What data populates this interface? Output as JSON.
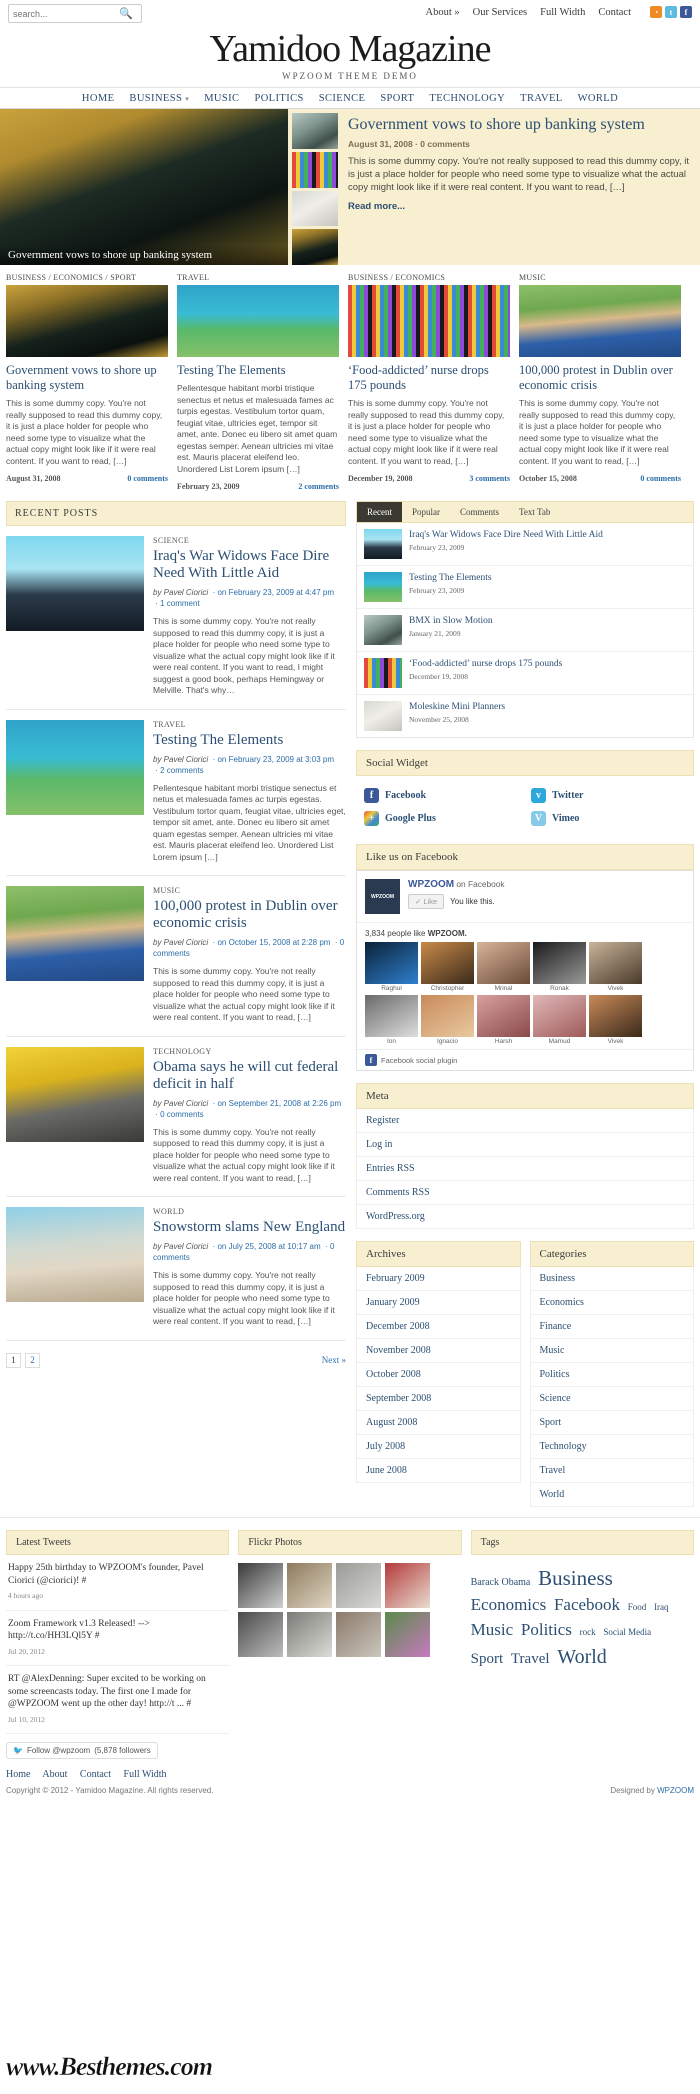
{
  "topbar": {
    "search_placeholder": "search...",
    "search_value": "",
    "search_icon": "search-icon",
    "links": [
      {
        "label": "About »"
      },
      {
        "label": "Our Services"
      },
      {
        "label": "Full Width"
      },
      {
        "label": "Contact"
      }
    ],
    "social": [
      {
        "name": "rss",
        "glyph": "◔"
      },
      {
        "name": "twitter",
        "glyph": "t"
      },
      {
        "name": "facebook",
        "glyph": "f"
      }
    ]
  },
  "masthead": {
    "logo": "Yamidoo Magazine",
    "tagline": "WPZOOM THEME DEMO"
  },
  "mainnav": [
    {
      "label": "HOME",
      "caret": ""
    },
    {
      "label": "BUSINESS",
      "caret": "▾"
    },
    {
      "label": "MUSIC",
      "caret": ""
    },
    {
      "label": "POLITICS",
      "caret": ""
    },
    {
      "label": "SCIENCE",
      "caret": ""
    },
    {
      "label": "SPORT",
      "caret": ""
    },
    {
      "label": "TECHNOLOGY",
      "caret": ""
    },
    {
      "label": "TRAVEL",
      "caret": ""
    },
    {
      "label": "WORLD",
      "caret": ""
    }
  ],
  "featured": {
    "caption": "Government vows to shore up banking system",
    "title": "Government vows to shore up banking system",
    "meta": "August 31, 2008 · 0 comments",
    "body": "This is some dummy copy. You're not really supposed to read this dummy copy, it is just a place holder for people who need some type to visualize what the actual copy might look like if it were real content. If you want to read, […]",
    "read_more": "Read more..."
  },
  "columns": [
    {
      "category": "BUSINESS / ECONOMICS / SPORT",
      "title": "Government vows to shore up banking system",
      "body": "This is some dummy copy. You're not really supposed to read this dummy copy, it is just a place holder for people who need some type to visualize what the actual copy might look like if it were real content. If you want to read, […]",
      "date": "August 31, 2008",
      "comments": "0 comments"
    },
    {
      "category": "TRAVEL",
      "title": "Testing The Elements",
      "body": "Pellentesque habitant morbi tristique senectus et netus et malesuada fames ac turpis egestas. Vestibulum tortor quam, feugiat vitae, ultricies eget, tempor sit amet, ante. Donec eu libero sit amet quam egestas semper. Aenean ultricies mi vitae est. Mauris placerat eleifend leo. Unordered List Lorem ipsum […]",
      "date": "February 23, 2009",
      "comments": "2 comments"
    },
    {
      "category": "BUSINESS / ECONOMICS",
      "title": "‘Food-addicted’ nurse drops 175 pounds",
      "body": "This is some dummy copy. You're not really supposed to read this dummy copy, it is just a place holder for people who need some type to visualize what the actual copy might look like if it were real content. If you want to read, […]",
      "date": "December 19, 2008",
      "comments": "3 comments"
    },
    {
      "category": "MUSIC",
      "title": "100,000 protest in Dublin over economic crisis",
      "body": "This is some dummy copy. You're not really supposed to read this dummy copy, it is just a place holder for people who need some type to visualize what the actual copy might look like if it were real content. If you want to read, […]",
      "date": "October 15, 2008",
      "comments": "0 comments"
    }
  ],
  "recent_posts": {
    "heading": "RECENT POSTS",
    "items": [
      {
        "category": "SCIENCE",
        "title": "Iraq's War Widows Face Dire Need With Little Aid",
        "meta_by": "by Pavel Ciorici",
        "meta_date": "on February 23, 2009 at 4:47 pm",
        "meta_comments": "1 comment",
        "body": "This is some dummy copy. You're not really supposed to read this dummy copy, it is just a place holder for people who need some type to visualize what the actual copy might look like if it were real content. If you want to read, I might suggest a good book, perhaps Hemingway or Melville. That's why…"
      },
      {
        "category": "TRAVEL",
        "title": "Testing The Elements",
        "meta_by": "by Pavel Ciorici",
        "meta_date": "on February 23, 2009 at 3:03 pm",
        "meta_comments": "2 comments",
        "body": "Pellentesque habitant morbi tristique senectus et netus et malesuada fames ac turpis egestas. Vestibulum tortor quam, feugiat vitae, ultricies eget, tempor sit amet, ante. Donec eu libero sit amet quam egestas semper. Aenean ultricies mi vitae est. Mauris placerat eleifend leo. Unordered List Lorem ipsum […]"
      },
      {
        "category": "MUSIC",
        "title": "100,000 protest in Dublin over economic crisis",
        "meta_by": "by Pavel Ciorici",
        "meta_date": "on October 15, 2008 at 2:28 pm",
        "meta_comments": "0 comments",
        "body": "This is some dummy copy. You're not really supposed to read this dummy copy, it is just a place holder for people who need some type to visualize what the actual copy might look like if it were real content. If you want to read, […]"
      },
      {
        "category": "TECHNOLOGY",
        "title": "Obama says he will cut federal deficit in half",
        "meta_by": "by Pavel Ciorici",
        "meta_date": "on September 21, 2008 at 2:26 pm",
        "meta_comments": "0 comments",
        "body": "This is some dummy copy. You're not really supposed to read this dummy copy, it is just a place holder for people who need some type to visualize what the actual copy might look like if it were real content. If you want to read, […]"
      },
      {
        "category": "WORLD",
        "title": "Snowstorm slams New England",
        "meta_by": "by Pavel Ciorici",
        "meta_date": "on July 25, 2008 at 10:17 am",
        "meta_comments": "0 comments",
        "body": "This is some dummy copy. You're not really supposed to read this dummy copy, it is just a place holder for people who need some type to visualize what the actual copy might look like if it were real content. If you want to read, […]"
      }
    ],
    "pagination": {
      "pages": [
        "1",
        "2"
      ],
      "current": "1",
      "next": "Next »"
    }
  },
  "sidebar": {
    "tabs": [
      {
        "label": "Recent",
        "active": true
      },
      {
        "label": "Popular",
        "active": false
      },
      {
        "label": "Comments",
        "active": false
      },
      {
        "label": "Text Tab",
        "active": false
      }
    ],
    "tab_items": [
      {
        "title": "Iraq's War Widows Face Dire Need With Little Aid",
        "date": "February 23, 2009"
      },
      {
        "title": "Testing The Elements",
        "date": "February 23, 2009"
      },
      {
        "title": "BMX in Slow Motion",
        "date": "January 21, 2009"
      },
      {
        "title": "‘Food-addicted’ nurse drops 175 pounds",
        "date": "December 19, 2008"
      },
      {
        "title": "Moleskine Mini Planners",
        "date": "November 25, 2008"
      }
    ],
    "social_widget": {
      "title": "Social Widget",
      "items": [
        {
          "label": "Facebook",
          "icon": "facebook-icon",
          "glyph": "f",
          "color": "#3b5998"
        },
        {
          "label": "Twitter",
          "icon": "twitter-icon",
          "glyph": "ᴠ",
          "color": "#2ca8dc"
        },
        {
          "label": "Google Plus",
          "icon": "google-plus-icon",
          "glyph": "+",
          "color": "#3a3a3a"
        },
        {
          "label": "Vimeo",
          "icon": "vimeo-icon",
          "glyph": "V",
          "color": "#86c9e8"
        }
      ]
    },
    "facebook": {
      "title": "Like us on Facebook",
      "page_name": "WPZOOM",
      "page_suffix": " on Facebook",
      "logo_text": "WPZOOM",
      "like_button": "✓ Like",
      "like_status": "You like this.",
      "count_prefix": "3,834 people like ",
      "count_name": "WPZOOM.",
      "people": [
        {
          "name": "Raghul"
        },
        {
          "name": "Christopher"
        },
        {
          "name": "Mrinal"
        },
        {
          "name": "Ronak"
        },
        {
          "name": "Vivek"
        },
        {
          "name": "Ion"
        },
        {
          "name": "Ignacio"
        },
        {
          "name": "Harsh"
        },
        {
          "name": "Mamud"
        },
        {
          "name": "Vivek"
        }
      ],
      "plugin_note": "Facebook social plugin"
    },
    "meta": {
      "title": "Meta",
      "links": [
        "Register",
        "Log in",
        "Entries RSS",
        "Comments RSS",
        "WordPress.org"
      ]
    },
    "archives": {
      "title": "Archives",
      "links": [
        "February 2009",
        "January 2009",
        "December 2008",
        "November 2008",
        "October 2008",
        "September 2008",
        "August 2008",
        "July 2008",
        "June 2008"
      ]
    },
    "categories": {
      "title": "Categories",
      "links": [
        "Business",
        "Economics",
        "Finance",
        "Music",
        "Politics",
        "Science",
        "Sport",
        "Technology",
        "Travel",
        "World"
      ]
    }
  },
  "footer_widgets": {
    "tweets": {
      "title": "Latest Tweets",
      "items": [
        {
          "text": "Happy 25th birthday to WPZOOM's founder, Pavel Ciorici (@ciorici)! #",
          "date": "4 hours ago"
        },
        {
          "text": "Zoom Framework v1.3 Released! --> http://t.co/HH3LQl5Y #",
          "date": "Jul 20, 2012"
        },
        {
          "text": "RT @AlexDenning: Super excited to be working on some screencasts today. The first one I made for @WPZOOM went up the other day! http://t ... #",
          "date": "Jul 10, 2012"
        }
      ],
      "follow_label": "Follow @wpzoom",
      "follow_count": "(5,878 followers"
    },
    "flickr": {
      "title": "Flickr Photos",
      "count": 8
    },
    "tags": {
      "title": "Tags",
      "items": [
        {
          "label": "Barack Obama",
          "size": 10
        },
        {
          "label": "Business",
          "size": 21
        },
        {
          "label": "Economics",
          "size": 17
        },
        {
          "label": "Facebook",
          "size": 17
        },
        {
          "label": "Food",
          "size": 9
        },
        {
          "label": "Iraq",
          "size": 9
        },
        {
          "label": "Music",
          "size": 17
        },
        {
          "label": "Politics",
          "size": 17
        },
        {
          "label": "rock",
          "size": 9
        },
        {
          "label": "Social Media",
          "size": 9
        },
        {
          "label": "Sport",
          "size": 15
        },
        {
          "label": "Travel",
          "size": 15
        },
        {
          "label": "World",
          "size": 20
        }
      ]
    }
  },
  "bottom": {
    "nav": [
      "Home",
      "About",
      "Contact",
      "Full Width"
    ],
    "copyright": "Copyright © 2012 - Yamidoo Magazine. All rights reserved.",
    "designed_by_prefix": "Designed by ",
    "designed_by": "WPZOOM",
    "watermark": "www.Besthemes.com"
  }
}
